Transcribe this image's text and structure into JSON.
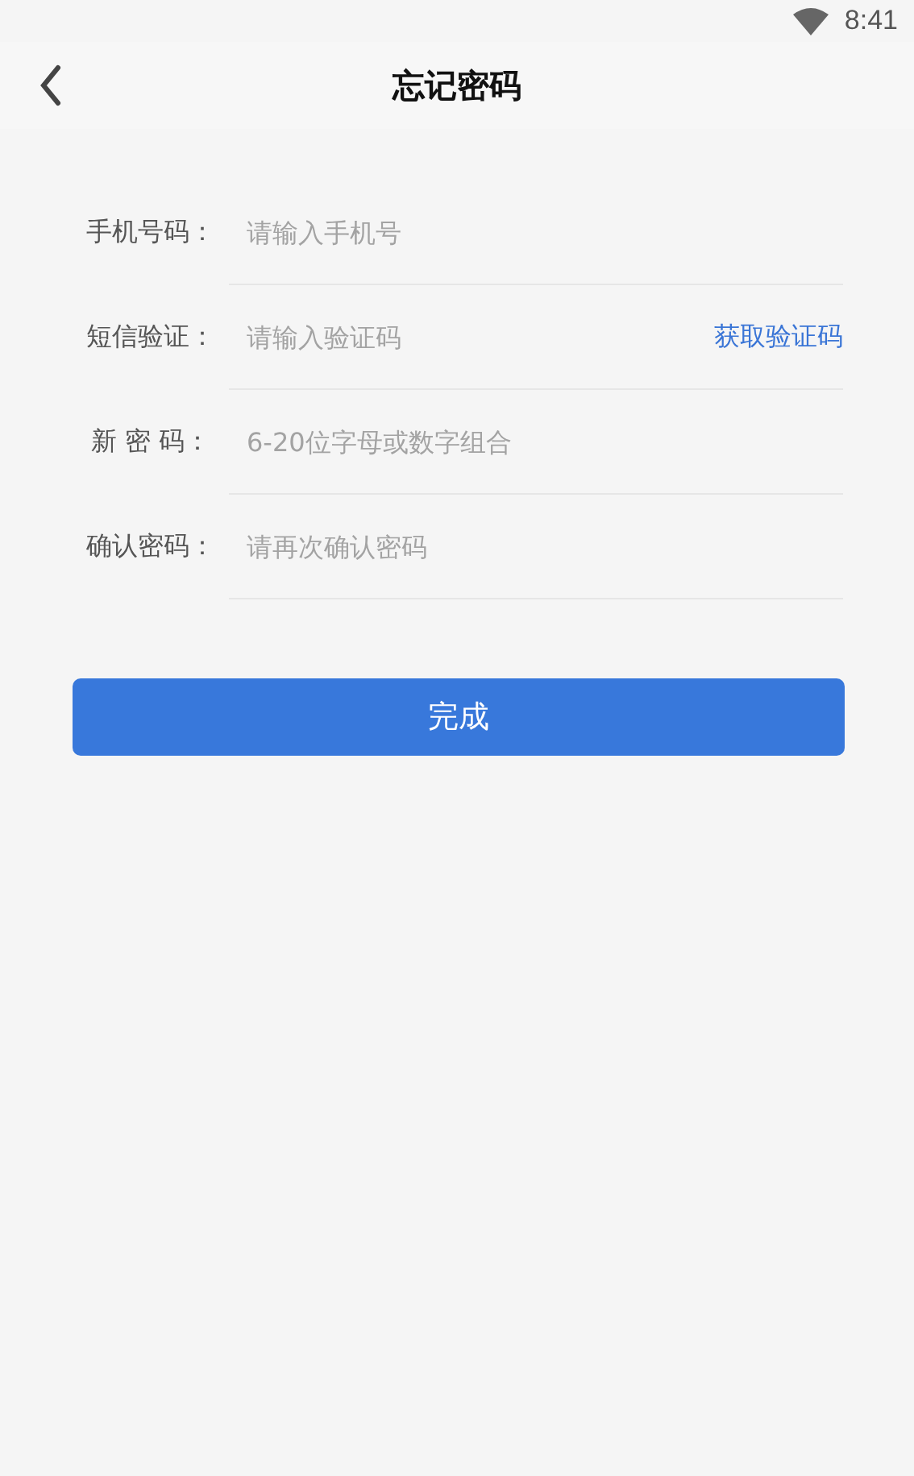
{
  "status_bar": {
    "time": "8:41"
  },
  "header": {
    "title": "忘记密码"
  },
  "fields": [
    {
      "label": "手机号码：",
      "placeholder": "请输入手机号"
    },
    {
      "label": "短信验证：",
      "placeholder": "请输入验证码",
      "action": "获取验证码"
    },
    {
      "label": "新 密 码：",
      "placeholder": "6-20位字母或数字组合"
    },
    {
      "label": "确认密码：",
      "placeholder": "请再次确认密码"
    }
  ],
  "submit": "完成"
}
